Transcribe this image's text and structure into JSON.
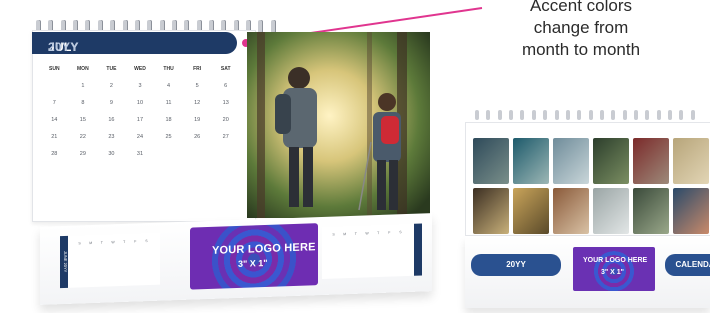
{
  "callout": {
    "line1": "Accent colors",
    "line2": "change from",
    "line3": "month to month",
    "accent_color": "#e0358f"
  },
  "main_calendar": {
    "month": "JULY",
    "year": "20YY",
    "header_color": "#1e3a66",
    "days_of_week": [
      "SUN",
      "MON",
      "TUE",
      "WED",
      "THU",
      "FRI",
      "SAT"
    ],
    "dates": [
      "",
      "1",
      "2",
      "3",
      "4",
      "5",
      "6",
      "7",
      "8",
      "9",
      "10",
      "11",
      "12",
      "13",
      "14",
      "15",
      "16",
      "17",
      "18",
      "19",
      "20",
      "21",
      "22",
      "23",
      "24",
      "25",
      "26",
      "27",
      "28",
      "29",
      "30",
      "31",
      "",
      "",
      ""
    ],
    "logo_text": "YOUR LOGO HERE",
    "logo_size": "3\" X 1\"",
    "mini_dow": [
      "S",
      "M",
      "T",
      "W",
      "T",
      "F",
      "S"
    ],
    "mini_side_left": "JUNE 20YY"
  },
  "small_calendar": {
    "year_label": "20YY",
    "calendar_label": "CALENDA",
    "logo_text": "YOUR LOGO HERE",
    "logo_size": "3\" X 1\"",
    "pill_color": "#2a5190"
  }
}
